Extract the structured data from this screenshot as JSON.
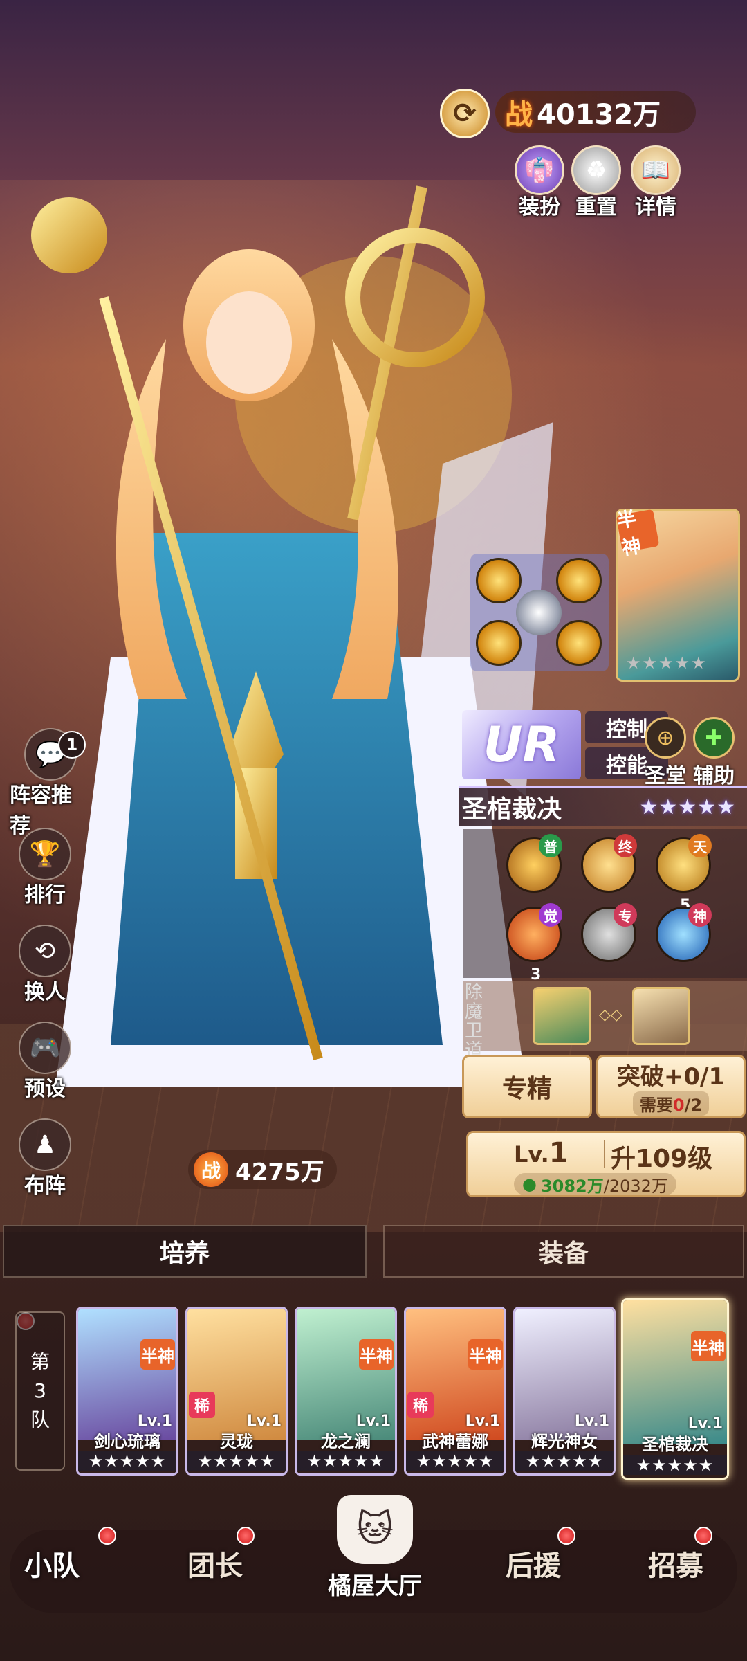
{
  "combat_power": {
    "prefix": "战",
    "value": "40132万"
  },
  "top_actions": [
    {
      "label": "装扮",
      "icon": "dress-icon"
    },
    {
      "label": "重置",
      "icon": "reset-icon"
    },
    {
      "label": "详情",
      "icon": "book-icon"
    }
  ],
  "left_menu": [
    {
      "label": "阵容推荐",
      "icon": "chat-icon",
      "badge": "1"
    },
    {
      "label": "排行",
      "icon": "trophy-icon"
    },
    {
      "label": "换人",
      "icon": "swap-icon"
    },
    {
      "label": "预设",
      "icon": "gamepad-icon"
    },
    {
      "label": "布阵",
      "icon": "formation-icon"
    }
  ],
  "team_power": {
    "prefix": "战",
    "value": "4275万"
  },
  "hero": {
    "portrait_tag": "半神",
    "rarity": "UR",
    "roles": [
      "控制",
      "控能"
    ],
    "classes": [
      {
        "label": "圣堂",
        "icon": "crosshair-icon"
      },
      {
        "label": "辅助",
        "icon": "plus-icon"
      }
    ],
    "name": "圣棺裁决",
    "stars": "★★★★★",
    "skills": [
      {
        "tag": "普",
        "level": ""
      },
      {
        "tag": "终",
        "level": ""
      },
      {
        "tag": "天",
        "level": "5"
      },
      {
        "tag": "觉",
        "level": "3"
      },
      {
        "tag": "专",
        "level": ""
      },
      {
        "tag": "神",
        "level": ""
      }
    ],
    "bond_label": "除魔卫道",
    "specialize_label": "专精",
    "breakthrough": {
      "label": "突破+0/1",
      "need_prefix": "需要",
      "need_have": "0",
      "need_total": "/2"
    },
    "level": {
      "prefix": "Lv.",
      "value": "1",
      "upgrade": "升109级",
      "cost_have": "3082万",
      "cost_total": "/2032万"
    }
  },
  "tabs": [
    {
      "label": "培养"
    },
    {
      "label": "装备"
    }
  ],
  "team_label": [
    "第",
    "3",
    "队"
  ],
  "team_heroes": [
    {
      "name": "剑心琉璃",
      "level": "Lv.1",
      "tag": "半神",
      "rare": "",
      "stars": "★★★★★"
    },
    {
      "name": "灵珑",
      "level": "Lv.1",
      "tag": "",
      "rare": "稀",
      "stars": "★★★★★"
    },
    {
      "name": "龙之澜",
      "level": "Lv.1",
      "tag": "半神",
      "rare": "",
      "stars": "★★★★★"
    },
    {
      "name": "武神蕾娜",
      "level": "Lv.1",
      "tag": "半神",
      "rare": "稀",
      "stars": "★★★★★"
    },
    {
      "name": "辉光神女",
      "level": "Lv.1",
      "tag": "",
      "rare": "",
      "stars": "★★★★★"
    },
    {
      "name": "圣棺裁决",
      "level": "Lv.1",
      "tag": "半神",
      "rare": "",
      "stars": "★★★★★"
    }
  ],
  "bottom_nav": [
    {
      "label": "小队"
    },
    {
      "label": "团长"
    },
    {
      "label": "橘屋大厅"
    },
    {
      "label": "后援"
    },
    {
      "label": "招募"
    }
  ],
  "colors": {
    "accent": "#ffb347",
    "badge_red": "#d01a1a",
    "panel_cream": "#f0cf98",
    "ur_purple": "#8a78d8"
  }
}
